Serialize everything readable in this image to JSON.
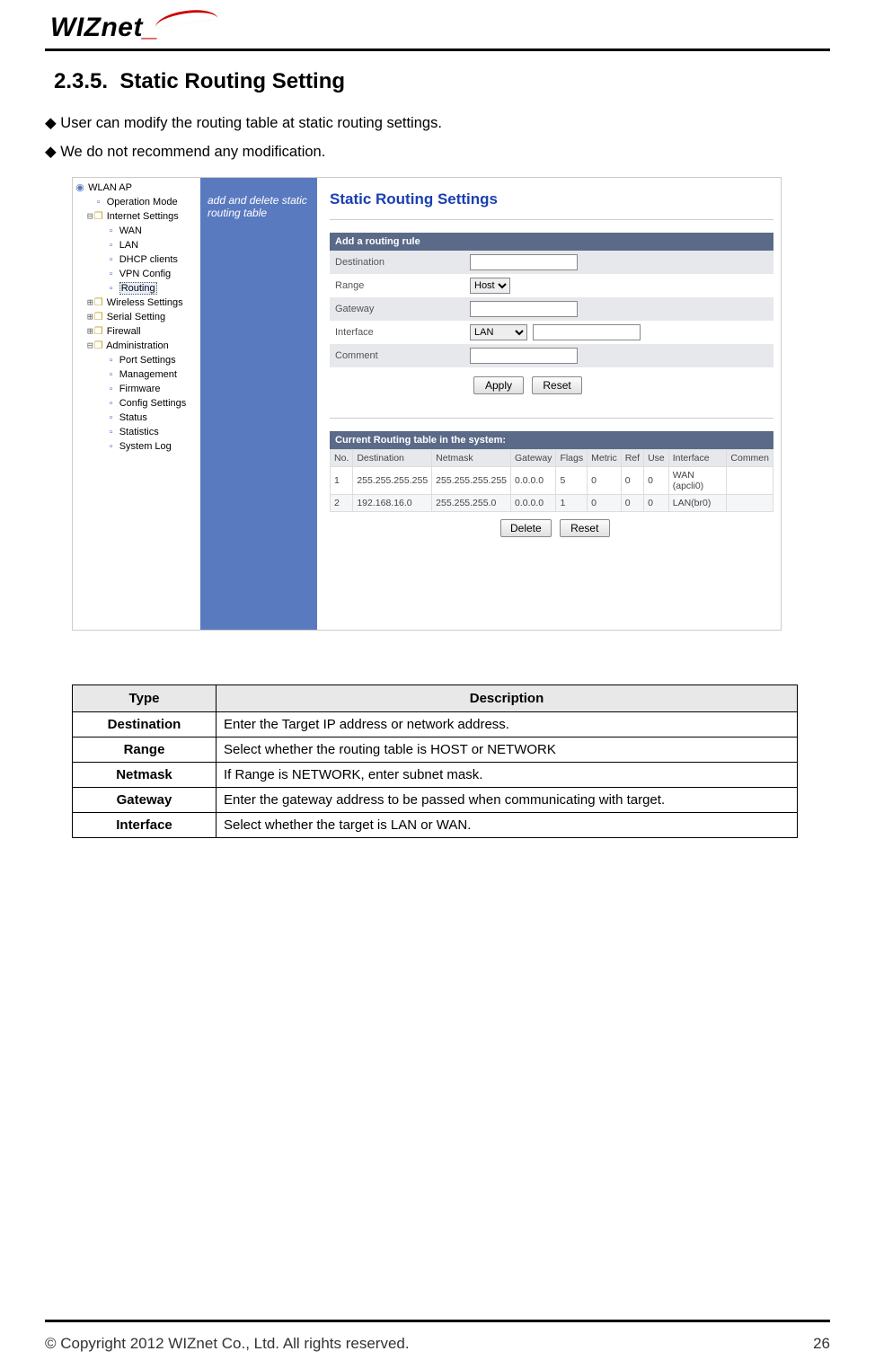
{
  "header": {
    "brand": "WIZnet"
  },
  "section": {
    "number": "2.3.5.",
    "title": "Static  Routing  Setting",
    "bullets": [
      "User can modify the routing table at static routing settings.",
      "We do not recommend any modification."
    ]
  },
  "screenshot": {
    "tree": {
      "root": "WLAN AP",
      "items": [
        {
          "label": "Operation Mode",
          "indent": 1,
          "icon": "page"
        },
        {
          "label": "Internet Settings",
          "indent": 1,
          "icon": "folder-open",
          "expander": "⊟"
        },
        {
          "label": "WAN",
          "indent": 2,
          "icon": "page"
        },
        {
          "label": "LAN",
          "indent": 2,
          "icon": "page"
        },
        {
          "label": "DHCP clients",
          "indent": 2,
          "icon": "page"
        },
        {
          "label": "VPN Config",
          "indent": 2,
          "icon": "page"
        },
        {
          "label": "Routing",
          "indent": 2,
          "icon": "page",
          "selected": true
        },
        {
          "label": "Wireless Settings",
          "indent": 1,
          "icon": "folder",
          "expander": "⊞"
        },
        {
          "label": "Serial Setting",
          "indent": 1,
          "icon": "folder",
          "expander": "⊞"
        },
        {
          "label": "Firewall",
          "indent": 1,
          "icon": "folder",
          "expander": "⊞"
        },
        {
          "label": "Administration",
          "indent": 1,
          "icon": "folder-open",
          "expander": "⊟"
        },
        {
          "label": "Port Settings",
          "indent": 2,
          "icon": "page"
        },
        {
          "label": "Management",
          "indent": 2,
          "icon": "page"
        },
        {
          "label": "Firmware",
          "indent": 2,
          "icon": "page"
        },
        {
          "label": "Config Settings",
          "indent": 2,
          "icon": "page"
        },
        {
          "label": "Status",
          "indent": 2,
          "icon": "page"
        },
        {
          "label": "Statistics",
          "indent": 2,
          "icon": "page"
        },
        {
          "label": "System Log",
          "indent": 2,
          "icon": "page"
        }
      ]
    },
    "sidehelp": "add and delete static routing table",
    "main": {
      "title": "Static Routing Settings",
      "add_bar": "Add a routing rule",
      "fields": {
        "destination": "Destination",
        "range": "Range",
        "range_value": "Host",
        "gateway": "Gateway",
        "interface": "Interface",
        "interface_value": "LAN",
        "comment": "Comment"
      },
      "buttons": {
        "apply": "Apply",
        "reset": "Reset",
        "delete": "Delete"
      },
      "table_bar": "Current Routing table in the system:",
      "table": {
        "headers": [
          "No.",
          "Destination",
          "Netmask",
          "Gateway",
          "Flags",
          "Metric",
          "Ref",
          "Use",
          "Interface",
          "Commen"
        ],
        "rows": [
          [
            "1",
            "255.255.255.255",
            "255.255.255.255",
            "0.0.0.0",
            "5",
            "0",
            "0",
            "0",
            "WAN (apcli0)",
            ""
          ],
          [
            "2",
            "192.168.16.0",
            "255.255.255.0",
            "0.0.0.0",
            "1",
            "0",
            "0",
            "0",
            "LAN(br0)",
            ""
          ]
        ]
      }
    }
  },
  "desc_table": {
    "headers": {
      "type": "Type",
      "description": "Description"
    },
    "rows": [
      {
        "k": "Destination",
        "v": "Enter the Target IP address or network address."
      },
      {
        "k": "Range",
        "v": "Select whether the routing table is HOST or NETWORK"
      },
      {
        "k": "Netmask",
        "v": "If Range is NETWORK, enter subnet mask."
      },
      {
        "k": "Gateway",
        "v": "Enter the gateway address to be passed when communicating with target."
      },
      {
        "k": "Interface",
        "v": "Select whether the target is LAN or WAN."
      }
    ]
  },
  "footer": {
    "copyright": "© Copyright 2012 WIZnet Co., Ltd. All rights reserved.",
    "page": "26"
  }
}
